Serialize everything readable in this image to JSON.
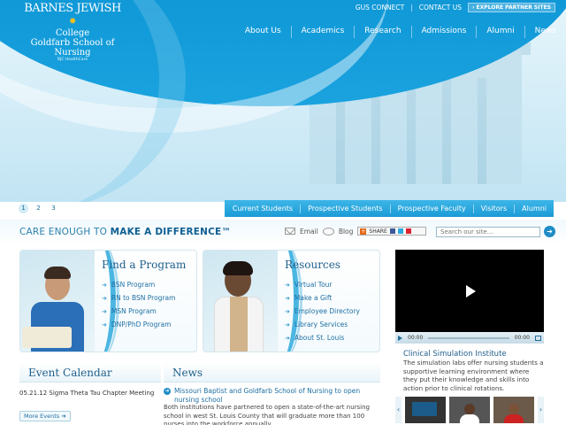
{
  "logo": {
    "line1": "BARNES JEWISH",
    "line2": "College",
    "line3": "Goldfarb School of Nursing",
    "line4": "BJC HealthCare"
  },
  "utility": {
    "gus_connect": "GUS CONNECT",
    "separator": "|",
    "contact_us": "CONTACT US",
    "explore": "EXPLORE PARTNER SITES"
  },
  "main_nav": [
    "About Us",
    "Academics",
    "Research",
    "Admissions",
    "Alumni",
    "News"
  ],
  "slides": [
    "1",
    "2",
    "3"
  ],
  "audience_nav": [
    "Current Students",
    "Prospective Students",
    "Prospective Faculty",
    "Visitors",
    "Alumni"
  ],
  "tagline": {
    "part1": "CARE ENOUGH TO ",
    "part2": "MAKE A DIFFERENCE™"
  },
  "share": {
    "email": "Email",
    "blog": "Blog",
    "share_label": "SHARE"
  },
  "search": {
    "placeholder": "Search our site..."
  },
  "find_program": {
    "title": "Find a Program",
    "links": [
      "BSN Program",
      "RN to BSN Program",
      "MSN Program",
      "DNP/PhD Program"
    ]
  },
  "resources": {
    "title": "Resources",
    "links": [
      "Virtual Tour",
      "Make a Gift",
      "Employee Directory",
      "Library Services",
      "About St. Louis"
    ]
  },
  "video": {
    "time_current": "00:00",
    "time_total": "00:00",
    "title": "Clinical Simulation Institute",
    "description": "The simulation labs offer nursing students a supportive learning environment where they put their knowledge and skills into action prior to clinical rotations."
  },
  "events": {
    "title": "Event Calendar",
    "item": "05.21.12 Sigma Theta Tau Chapter Meeting",
    "more": "More Events"
  },
  "news": {
    "title": "News",
    "headline": "Missouri Baptist and Goldfarb School of Nursing to open nursing school",
    "body": "Both institutions have partnered to open a state-of-the-art nursing school in west St. Louis County that will graduate more than 100 nurses into the workforce annually."
  },
  "colors": {
    "brand_blue": "#0f97d6",
    "link_blue": "#1d6fa3",
    "accent_yellow": "#f8c21a"
  }
}
